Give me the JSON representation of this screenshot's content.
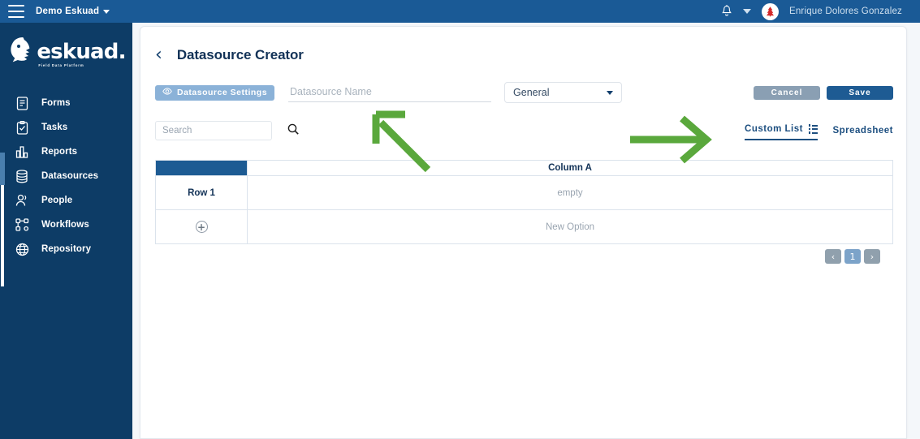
{
  "topbar": {
    "menu_icon": "hamburger-icon",
    "tenant_label": "Demo Eskuad",
    "tenant_caret": "chevron-down-icon",
    "bell_icon": "notification-bell-icon",
    "user_caret": "chevron-down-icon",
    "avatar_icon": "tree-avatar-icon",
    "username": "Enrique Dolores Gonzalez"
  },
  "sidebar": {
    "logo_word": "eskuad",
    "logo_dot": ".",
    "logo_tagline": "Field Data Platform",
    "items": [
      {
        "label": "Forms",
        "icon": "document-icon"
      },
      {
        "label": "Tasks",
        "icon": "clipboard-check-icon"
      },
      {
        "label": "Reports",
        "icon": "bar-chart-icon"
      },
      {
        "label": "Datasources",
        "icon": "database-icon"
      },
      {
        "label": "People",
        "icon": "people-icon"
      },
      {
        "label": "Workflows",
        "icon": "workflow-icon"
      },
      {
        "label": "Repository",
        "icon": "globe-icon"
      }
    ]
  },
  "page": {
    "back_icon": "chevron-left-icon",
    "title": "Datasource Creator"
  },
  "toolbar": {
    "settings_button": "Datasource Settings",
    "settings_icon": "eye-icon",
    "name_placeholder": "Datasource Name",
    "name_value": "",
    "category_selected": "General",
    "category_caret": "chevron-down-icon",
    "cancel_label": "Cancel",
    "save_label": "Save"
  },
  "search": {
    "placeholder": "Search",
    "value": "",
    "icon": "search-icon"
  },
  "tabs": [
    {
      "label": "Custom List",
      "icon": "list-icon",
      "active": true
    },
    {
      "label": "Spreadsheet",
      "icon": "",
      "active": false
    }
  ],
  "table": {
    "corner_header": "",
    "columns": [
      "Column A"
    ],
    "rows": [
      {
        "label": "Row 1",
        "cells": [
          "empty"
        ]
      }
    ],
    "add_row": {
      "icon": "plus-circle-icon",
      "cells": [
        "New Option"
      ]
    }
  },
  "pagination": {
    "prev": "‹",
    "pages": [
      "1"
    ],
    "next": "›",
    "current": "1"
  },
  "annotations": [
    {
      "name": "arrow-diagonal-up-left",
      "color": "#5aa83c"
    },
    {
      "name": "arrow-right",
      "color": "#5aa83c"
    }
  ],
  "colors": {
    "topbar_blue": "#1a5a96",
    "sidebar_blue": "#0d3c66",
    "accent_blue": "#1d5b93",
    "save_blue": "#1e5b93",
    "cancel_gray": "#8a9fb3",
    "settings_light_blue": "#8bb2d8",
    "annotation_green": "#5aa83c",
    "avatar_red": "#d42a2a"
  }
}
